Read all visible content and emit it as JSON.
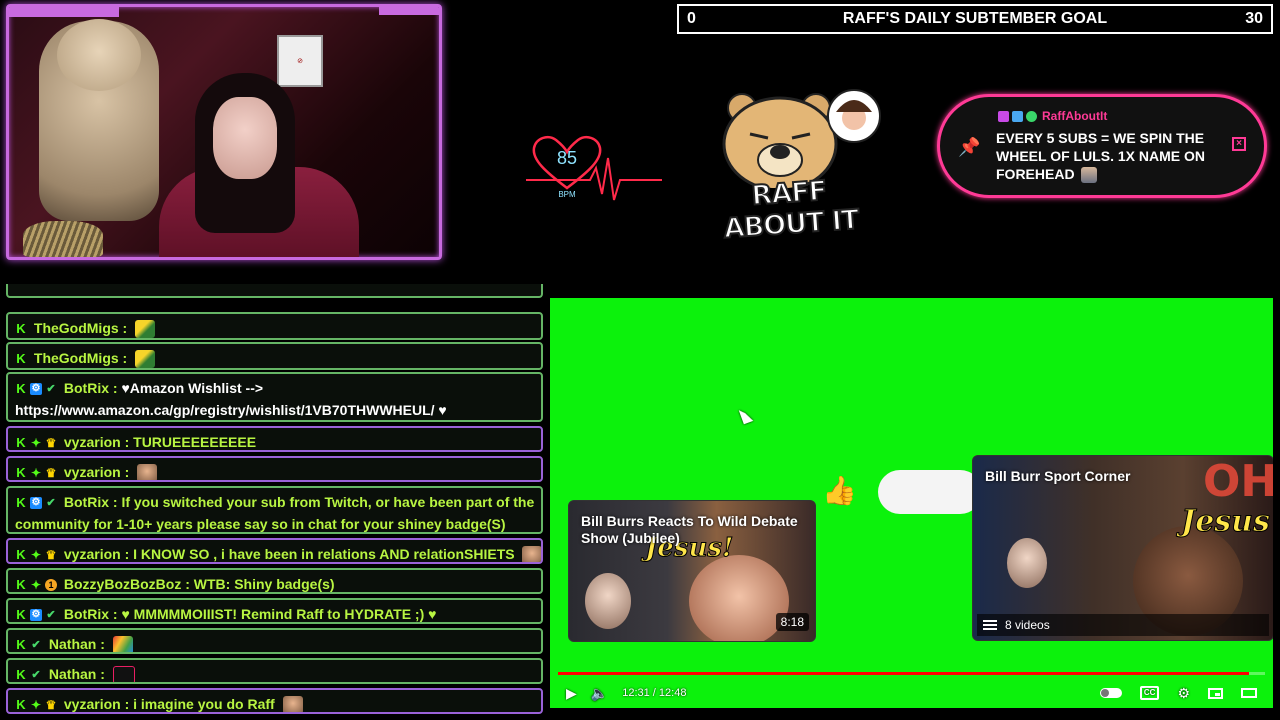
{
  "goal": {
    "current": "0",
    "title": "RAFF'S DAILY SUBTEMBER GOAL",
    "target": "30"
  },
  "heart_rate": {
    "value": "85",
    "unit": "BPM"
  },
  "logo": {
    "text": "RAFF ABOUT IT"
  },
  "alert": {
    "user": "RaffAboutIt",
    "message": "EVERY 5 SUBS = WE SPIN THE WHEEL OF LULS. 1X NAME ON FOREHEAD",
    "accent": "#ff3a96"
  },
  "chat": {
    "messages": [
      {
        "user": "TheGodMigs :",
        "text": "",
        "emote": "migs-emote"
      },
      {
        "user": "TheGodMigs :",
        "text": "",
        "emote": "migs-emote"
      },
      {
        "user": "BotRix :",
        "text": "♥Amazon Wishlist --> https://www.amazon.ca/gp/registry/wishlist/1VB70THWWHEUL/ ♥"
      },
      {
        "user": "vyzarion :",
        "text": "TURUEEEEEEEEE"
      },
      {
        "user": "vyzarion :",
        "text": "",
        "emote": "face-emote"
      },
      {
        "user": "BotRix :",
        "text": "If you switched your sub from Twitch, or have been part of the community for 1-10+ years please say so in chat for your shiney badge(S)"
      },
      {
        "user": "vyzarion :",
        "text": "I KNOW SO , i have been in relations AND relationSHIETS",
        "emote": "face-emote"
      },
      {
        "user": "BozzyBozBozBoz :",
        "text": "WTB: Shiny badge(s)"
      },
      {
        "user": "BotRix :",
        "text": "♥ MMMMMOIIIST! Remind Raff to HYDRATE ;) ♥"
      },
      {
        "user": "Nathan :",
        "text": "",
        "emote": "pride-emote"
      },
      {
        "user": "Nathan :",
        "text": "",
        "emote": "text-emote"
      },
      {
        "user": "vyzarion :",
        "text": "i imagine you do Raff",
        "emote": "face-emote"
      }
    ],
    "colors": {
      "username": "#b8f542",
      "border": "#65b565",
      "vip_border": "#9a62d8"
    }
  },
  "player": {
    "cards": [
      {
        "title": "Bill Burrs Reacts To Wild Debate Show (Jubilee)",
        "overlay": "Jesus!",
        "duration": "8:18"
      },
      {
        "title": "Bill Burr Sport Corner",
        "overlay": "Jesus",
        "badge": "OH",
        "playlist": "8 videos"
      }
    ],
    "time": "12:31 / 12:48",
    "progress": 0.978,
    "background": "#0cf20c"
  }
}
